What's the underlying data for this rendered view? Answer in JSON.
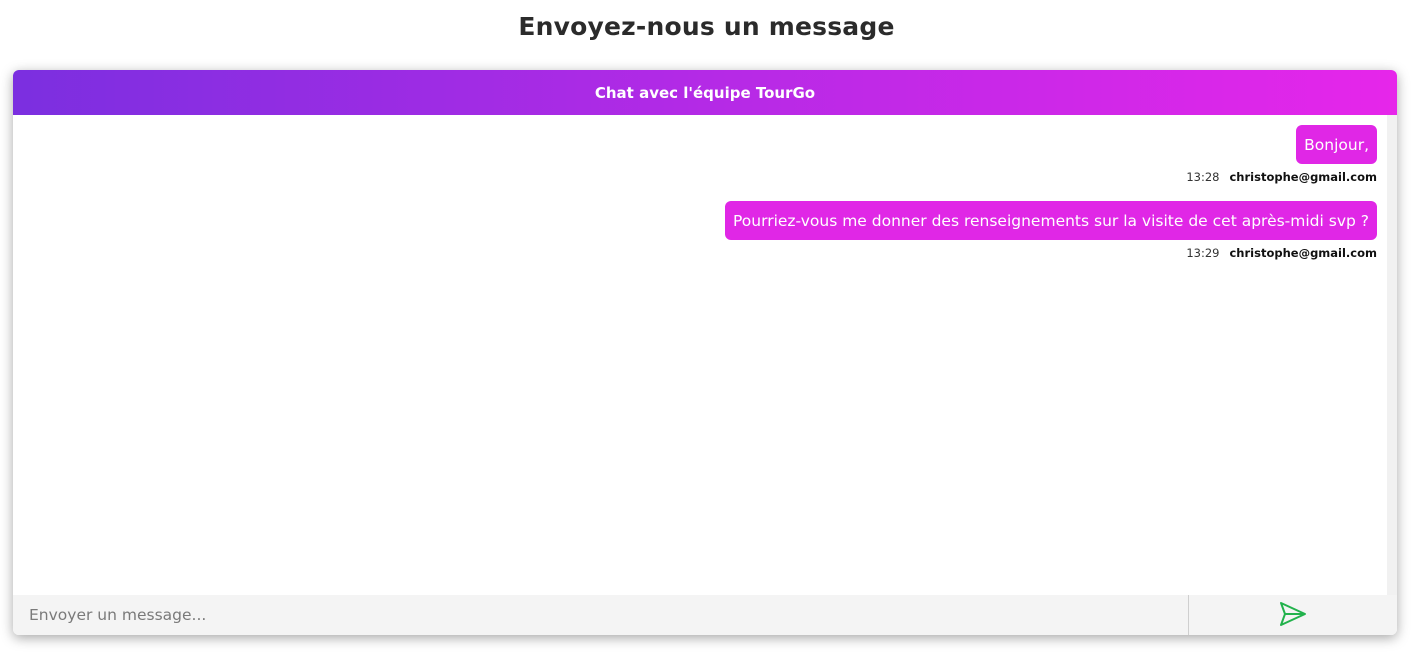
{
  "page": {
    "title": "Envoyez-nous un message"
  },
  "chat": {
    "header_title": "Chat avec l'équipe TourGo",
    "messages": [
      {
        "text": "Bonjour,",
        "time": "13:28",
        "sender": "christophe@gmail.com"
      },
      {
        "text": "Pourriez-vous me donner des renseignements sur la visite de cet après-midi svp ?",
        "time": "13:29",
        "sender": "christophe@gmail.com"
      }
    ],
    "input": {
      "placeholder": "Envoyer un message...",
      "value": ""
    },
    "send_icon": "send-arrow-icon"
  },
  "colors": {
    "header_gradient_start": "#7b2fe0",
    "header_gradient_end": "#e626ea",
    "bubble": "#e027e6",
    "send_icon": "#22b24c"
  }
}
